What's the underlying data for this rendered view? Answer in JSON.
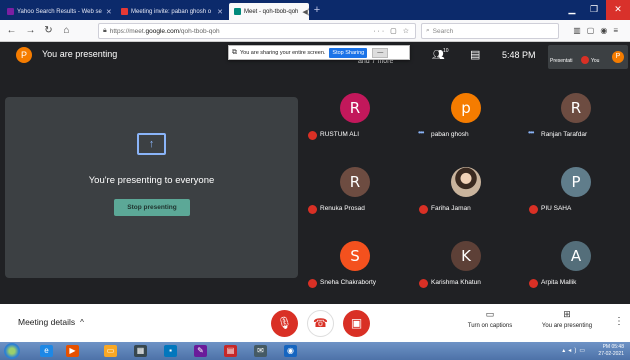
{
  "browser": {
    "tabs": [
      {
        "title": "Yahoo Search Results - Web se",
        "icon_color": "#7b1fa2"
      },
      {
        "title": "Meeting invite: paban ghosh o",
        "icon_color": "#e53935"
      },
      {
        "title": "Meet - qoh-tbob-qoh",
        "icon_color": "#00897b"
      }
    ],
    "url_prefix": "https://meet.",
    "url_host": "google.com",
    "url_path": "/qoh-tbob-qoh",
    "url_tools": "··· ▢ ☆",
    "search_placeholder": "Search"
  },
  "share_notice": {
    "text": "You are sharing your entire screen.",
    "stop_label": "Stop Sharing",
    "hide_label": "—"
  },
  "header": {
    "presenter_initial": "P",
    "presenting_label": "You are presenting",
    "more_people": "and 7 more",
    "people_count": "10",
    "clock": "5:48 PM",
    "thumb_label": "Presentati",
    "thumb_you": "You",
    "thumb_initial": "P"
  },
  "presenting_panel": {
    "icon": "arrow-up-icon",
    "message": "You're presenting to everyone",
    "stop_label": "Stop presenting"
  },
  "participants": [
    {
      "initial": "R",
      "name": "RUSTUM ALI",
      "color": "#c2185b",
      "status": "muted"
    },
    {
      "initial": "p",
      "name": "paban ghosh",
      "color": "#f57c00",
      "status": "speaking"
    },
    {
      "initial": "R",
      "name": "Ranjan Tarafdar",
      "color": "#6d4c41",
      "status": "speaking"
    },
    {
      "initial": "R",
      "name": "Renuka Prosad",
      "color": "#6d4c41",
      "status": "muted"
    },
    {
      "initial": "",
      "name": "Fariha Jaman",
      "color": "#c9b49d",
      "status": "muted",
      "photo": true
    },
    {
      "initial": "P",
      "name": "PIU SAHA",
      "color": "#607d8b",
      "status": "muted"
    },
    {
      "initial": "S",
      "name": "Sneha Chakraborty",
      "color": "#f4511e",
      "status": "muted"
    },
    {
      "initial": "K",
      "name": "Karishma Khatun",
      "color": "#5d4037",
      "status": "muted"
    },
    {
      "initial": "A",
      "name": "Arpita Mallik",
      "color": "#546e7a",
      "status": "muted"
    }
  ],
  "controls": {
    "meeting_details": "Meeting details",
    "captions_label": "Turn on captions",
    "present_label": "You are presenting"
  },
  "taskbar": {
    "time": "PM 05:48",
    "date": "27-02-2021"
  },
  "colors": {
    "meet_bg": "#202124",
    "tile_bg": "#3c4043",
    "accent_red": "#d93025",
    "stop_green": "#5ca897"
  }
}
